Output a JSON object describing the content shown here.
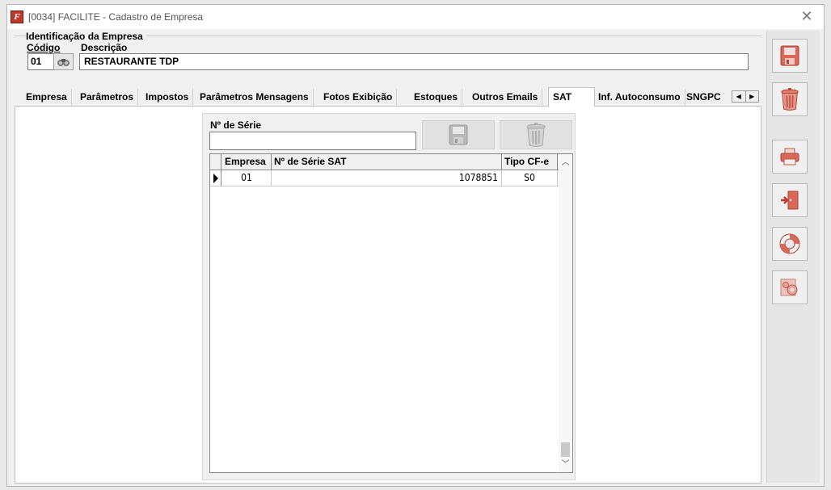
{
  "window": {
    "title": "[0034] FACILITE - Cadastro de Empresa",
    "close_glyph": "✕"
  },
  "identification": {
    "group_title": "Identificação da Empresa",
    "codigo_label": "Código",
    "descricao_label": "Descrição",
    "codigo_value": "01",
    "descricao_value": "RESTAURANTE TDP"
  },
  "tabs": [
    {
      "label": "Empresa"
    },
    {
      "label": "Parâmetros"
    },
    {
      "label": "Impostos"
    },
    {
      "label": "Parâmetros Mensagens"
    },
    {
      "label": "Fotos Exibição"
    },
    {
      "label": "Estoques"
    },
    {
      "label": "Outros Emails"
    },
    {
      "label": "SAT",
      "active": true
    },
    {
      "label": "Inf. Autoconsumo"
    },
    {
      "label": "SNGPC"
    }
  ],
  "sat": {
    "serie_label": "Nº de Série",
    "serie_value": "",
    "grid": {
      "columns": [
        "Empresa",
        "Nº de Série SAT",
        "Tipo CF-e"
      ],
      "rows": [
        {
          "empresa": "01",
          "serie": "1078851",
          "tipo": "S0"
        }
      ]
    }
  },
  "icons": {
    "app": "app-logo-icon",
    "lookup": "binoculars-icon",
    "save": "floppy-disk-icon",
    "delete": "trash-can-icon",
    "print": "printer-icon",
    "exit": "exit-door-icon",
    "help": "lifebuoy-icon",
    "settings": "gears-icon"
  },
  "colors": {
    "accent_red": "#c0392b",
    "window_bg": "#f0f0f0"
  }
}
